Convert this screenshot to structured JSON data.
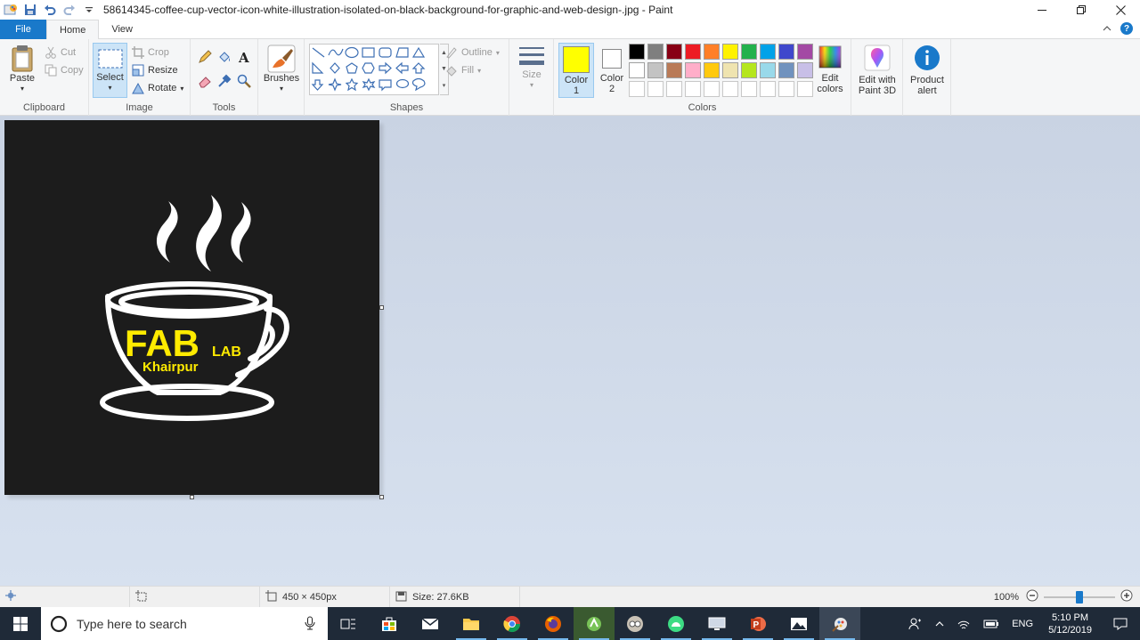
{
  "window": {
    "title": "58614345-coffee-cup-vector-icon-white-illustration-isolated-on-black-background-for-graphic-and-web-design-.jpg - Paint"
  },
  "tabs": [
    {
      "label": "File"
    },
    {
      "label": "Home"
    },
    {
      "label": "View"
    }
  ],
  "ribbon": {
    "clipboard": {
      "paste": "Paste",
      "cut": "Cut",
      "copy": "Copy",
      "group": "Clipboard"
    },
    "image": {
      "select": "Select",
      "crop": "Crop",
      "resize": "Resize",
      "rotate": "Rotate",
      "group": "Image"
    },
    "tools": {
      "group": "Tools"
    },
    "brushes": {
      "label": "Brushes"
    },
    "shapes": {
      "outline": "Outline",
      "fill": "Fill",
      "group": "Shapes"
    },
    "size": {
      "label": "Size"
    },
    "color1": {
      "line1": "Color",
      "line2": "1",
      "value": "#ffff00"
    },
    "color2": {
      "line1": "Color",
      "line2": "2",
      "value": "#ffffff"
    },
    "colors": {
      "group": "Colors",
      "edit_line1": "Edit",
      "edit_line2": "colors"
    },
    "paint3d": {
      "line1": "Edit with",
      "line2": "Paint 3D"
    },
    "product": {
      "line1": "Product",
      "line2": "alert"
    },
    "palette": [
      "#000000",
      "#7f7f7f",
      "#880015",
      "#ed1c24",
      "#ff7f27",
      "#fff200",
      "#22b14c",
      "#00a2e8",
      "#3f48cc",
      "#a349a4",
      "#ffffff",
      "#c3c3c3",
      "#b97a57",
      "#ffaec9",
      "#ffc90e",
      "#efe4b0",
      "#b5e61d",
      "#99d9ea",
      "#7092be",
      "#c8bfe7"
    ]
  },
  "image": {
    "logo_main": "FAB",
    "logo_sub": "LAB",
    "logo_place": "Khairpur"
  },
  "status": {
    "dimensions": "450 × 450px",
    "size": "Size: 27.6KB",
    "zoom": "100%"
  },
  "taskbar": {
    "search_placeholder": "Type here to search",
    "lang": "ENG",
    "time": "5:10 PM",
    "date": "5/12/2019"
  }
}
